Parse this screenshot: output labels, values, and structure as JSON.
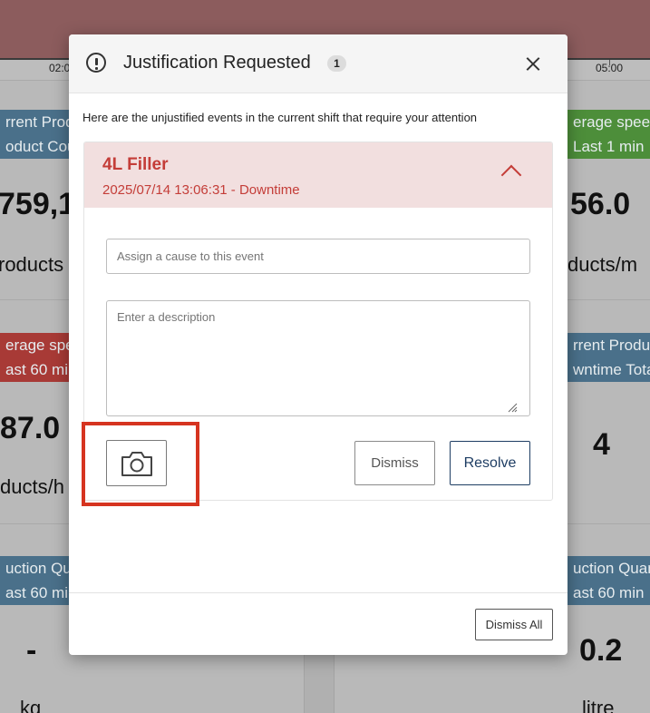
{
  "background": {
    "time_ticks": [
      "02:0",
      "05:00"
    ],
    "cards": [
      {
        "label1": "rrent Prod",
        "label2": "oduct Cou",
        "value": "759,1",
        "unit": "roducts"
      },
      {
        "label1": "erage speed",
        "label2": "Last 1 min",
        "value": "56.0",
        "unit": "ducts/m"
      },
      {
        "label1": "erage spe",
        "label2": "ast 60 min",
        "value": "87.0",
        "unit": "ducts/h"
      },
      {
        "label1": "rrent Produ",
        "label2": "wntime Tota",
        "value": "4",
        "unit": ""
      },
      {
        "label1": "uction Qua",
        "label2": "ast 60 min",
        "value": "-",
        "unit": "kg"
      },
      {
        "label1": "uction Quan",
        "label2": "ast 60 min",
        "value": "0.2",
        "unit": "litre"
      }
    ]
  },
  "modal": {
    "title": "Justification Requested",
    "badge_count": "1",
    "intro": "Here are the unjustified events in the current shift that require your attention",
    "event": {
      "name": "4L Filler",
      "subtitle": "2025/07/14 13:06:31 - Downtime",
      "cause_placeholder": "Assign a cause to this event",
      "description_placeholder": "Enter a description",
      "dismiss_label": "Dismiss",
      "resolve_label": "Resolve"
    },
    "dismiss_all_label": "Dismiss All"
  },
  "colors": {
    "event_accent": "#c43d38",
    "event_header_bg": "#f2dfdf",
    "resolve_border": "#1e3d63",
    "highlight": "#d63420"
  }
}
